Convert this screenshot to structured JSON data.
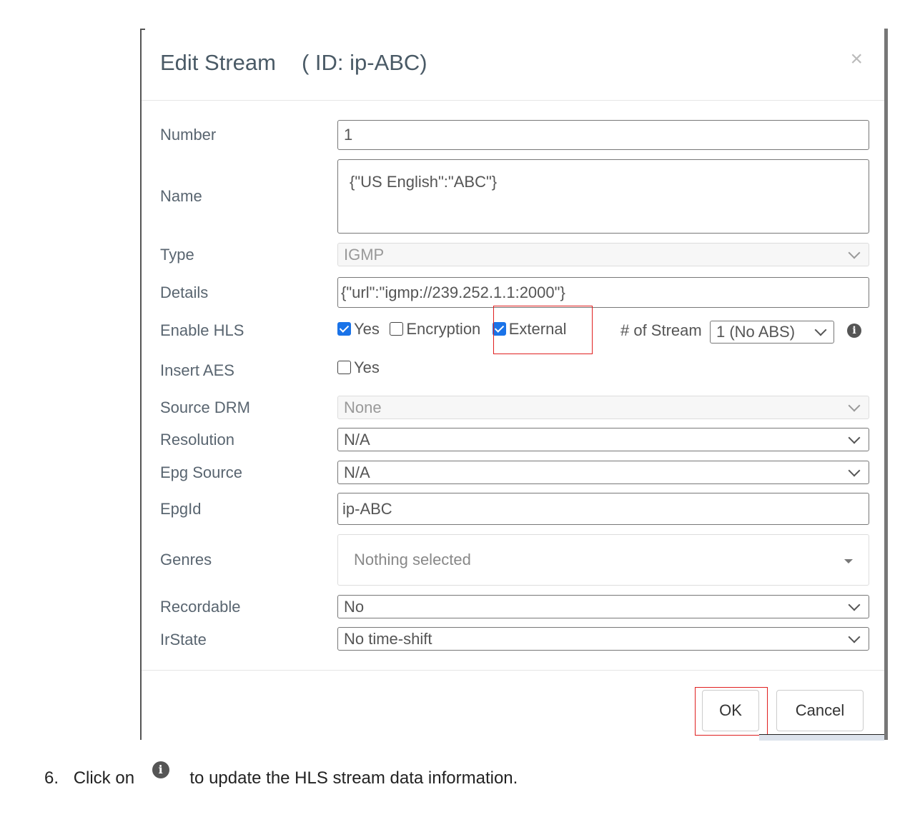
{
  "dialog": {
    "title": "Edit Stream",
    "id_label": "( ID: ip-ABC)",
    "close_glyph": "×"
  },
  "fields": {
    "number": {
      "label": "Number",
      "value": "1"
    },
    "name": {
      "label": "Name",
      "value": "{\"US English\":\"ABC\"}"
    },
    "type": {
      "label": "Type",
      "value": "IGMP"
    },
    "details": {
      "label": "Details",
      "value": "{\"url\":\"igmp://239.252.1.1:2000\"}"
    },
    "enable_hls": {
      "label": "Enable HLS",
      "yes_label": "Yes",
      "yes_checked": true,
      "encryption_label": "Encryption",
      "encryption_checked": false,
      "external_label": "External",
      "external_checked": true,
      "num_stream_label": "# of Stream",
      "num_stream_value": "1 (No ABS)"
    },
    "insert_aes": {
      "label": "Insert AES",
      "yes_label": "Yes",
      "checked": false
    },
    "source_drm": {
      "label": "Source DRM",
      "value": "None"
    },
    "resolution": {
      "label": "Resolution",
      "value": "N/A"
    },
    "epg_source": {
      "label": "Epg Source",
      "value": "N/A"
    },
    "epg_id": {
      "label": "EpgId",
      "value": "ip-ABC"
    },
    "genres": {
      "label": "Genres",
      "placeholder": "Nothing selected"
    },
    "recordable": {
      "label": "Recordable",
      "value": "No"
    },
    "ir_state": {
      "label": "IrState",
      "value": "No time-shift"
    }
  },
  "buttons": {
    "ok": "OK",
    "cancel": "Cancel"
  },
  "instruction": {
    "number": "6.",
    "before": "Click on",
    "after": "to update the HLS stream data information."
  },
  "colors": {
    "highlight": "#e02020",
    "checkbox": "#1a73e8"
  },
  "icons": [
    "close-icon",
    "chevron-down-icon",
    "info-icon",
    "caret-down-icon",
    "checkbox-icon"
  ]
}
